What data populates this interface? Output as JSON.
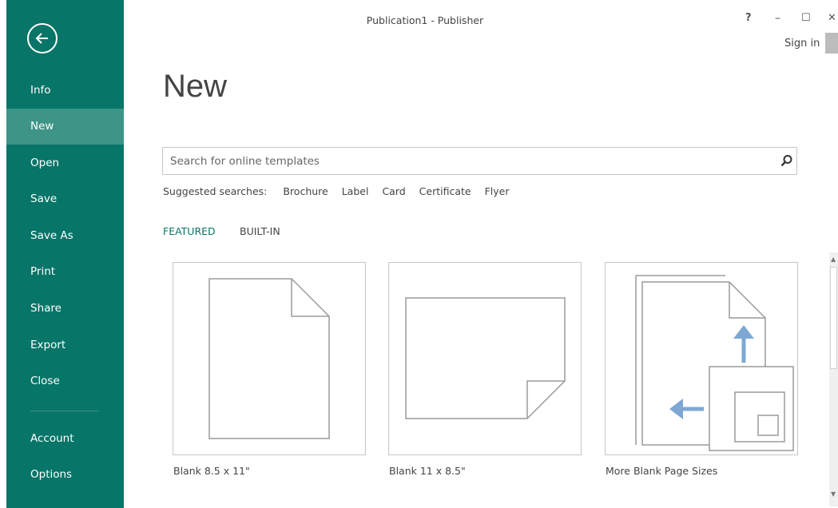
{
  "window": {
    "title": "Publication1 - Publisher",
    "help": "?",
    "minimize": "–",
    "maximize": "☐",
    "close": "✕",
    "sign_in": "Sign in"
  },
  "sidebar": {
    "back_icon": "back-arrow-icon",
    "items": [
      {
        "label": "Info"
      },
      {
        "label": "New",
        "active": true
      },
      {
        "label": "Open"
      },
      {
        "label": "Save"
      },
      {
        "label": "Save As"
      },
      {
        "label": "Print"
      },
      {
        "label": "Share"
      },
      {
        "label": "Export"
      },
      {
        "label": "Close"
      },
      {
        "label": "Account"
      },
      {
        "label": "Options"
      }
    ]
  },
  "main": {
    "title": "New",
    "search": {
      "placeholder": "Search for online templates",
      "icon": "search-icon"
    },
    "suggested": {
      "label": "Suggested searches:",
      "items": [
        "Brochure",
        "Label",
        "Card",
        "Certificate",
        "Flyer"
      ]
    },
    "tabs": [
      {
        "label": "FEATURED",
        "active": true
      },
      {
        "label": "BUILT-IN"
      }
    ],
    "templates": [
      {
        "label": "Blank 8.5 x 11\"",
        "icon": "portrait-page-icon"
      },
      {
        "label": "Blank 11 x 8.5\"",
        "icon": "landscape-page-icon"
      },
      {
        "label": "More Blank Page Sizes",
        "icon": "page-sizes-icon"
      }
    ]
  },
  "colors": {
    "sidebar": "#077568",
    "sidebar_active": "#3d9487",
    "accent": "#077568",
    "page_sizes_arrow": "#7ea8d3"
  }
}
